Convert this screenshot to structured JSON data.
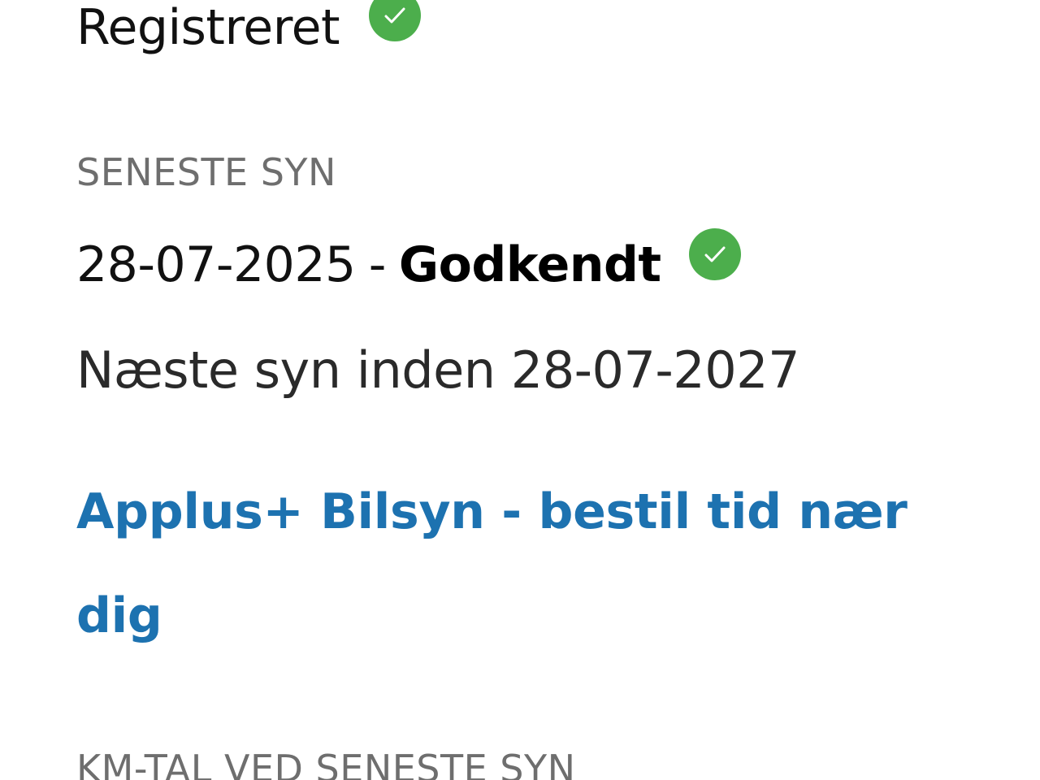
{
  "registration": {
    "status": "Registreret",
    "status_icon": "check-circle-icon",
    "status_color": "#4cae4c"
  },
  "latest_inspection": {
    "label": "SENESTE SYN",
    "date": "28-07-2025",
    "separator": "-",
    "result": "Godkendt",
    "result_icon": "check-circle-icon",
    "next": "Næste syn inden 28-07-2027"
  },
  "booking": {
    "link_text": "Applus+ Bilsyn - bestil tid nær dig",
    "link_color": "#1d72b0"
  },
  "km_section": {
    "label": "KM-TAL VED SENESTE SYN"
  }
}
